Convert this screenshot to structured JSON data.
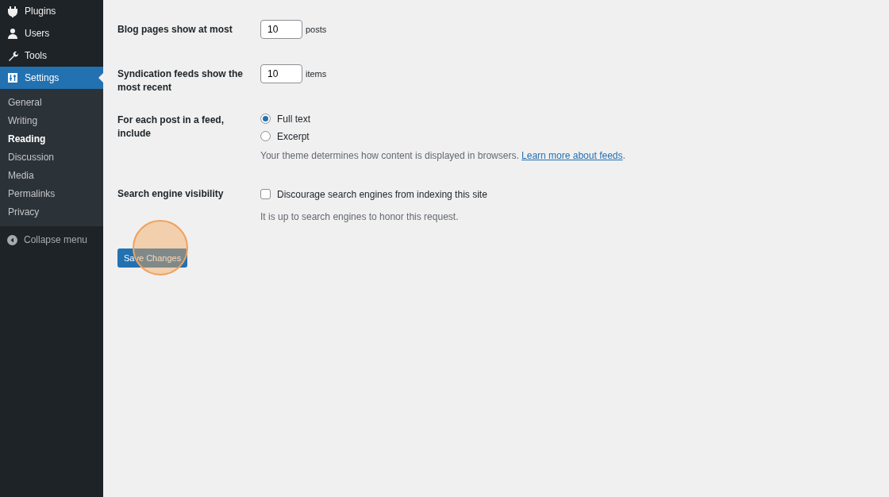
{
  "sidebar": {
    "items": [
      {
        "label": "Plugins",
        "selected": false
      },
      {
        "label": "Users",
        "selected": false
      },
      {
        "label": "Tools",
        "selected": false
      },
      {
        "label": "Settings",
        "selected": true
      }
    ],
    "submenu": [
      {
        "label": "General",
        "selected": false
      },
      {
        "label": "Writing",
        "selected": false
      },
      {
        "label": "Reading",
        "selected": true
      },
      {
        "label": "Discussion",
        "selected": false
      },
      {
        "label": "Media",
        "selected": false
      },
      {
        "label": "Permalinks",
        "selected": false
      },
      {
        "label": "Privacy",
        "selected": false
      }
    ],
    "collapse": "Collapse menu"
  },
  "form": {
    "rows": [
      {
        "kind": "number",
        "label": "Blog pages show at most",
        "value": "10",
        "unit": "posts"
      },
      {
        "kind": "number",
        "label": "Syndication feeds show the most recent",
        "value": "10",
        "unit": "items"
      },
      {
        "kind": "radio",
        "label": "For each post in a feed, include",
        "options": [
          {
            "label": "Full text",
            "selected": true
          },
          {
            "label": "Excerpt",
            "selected": false
          }
        ],
        "description": "Your theme determines how content is displayed in browsers. ",
        "link": "Learn more about feeds",
        "description_end": "."
      },
      {
        "kind": "checkbox",
        "label": "Search engine visibility",
        "option": "Discourage search engines from indexing this site",
        "checked": false,
        "description": "It is up to search engines to honor this request."
      }
    ],
    "save_button": "Save Changes"
  }
}
